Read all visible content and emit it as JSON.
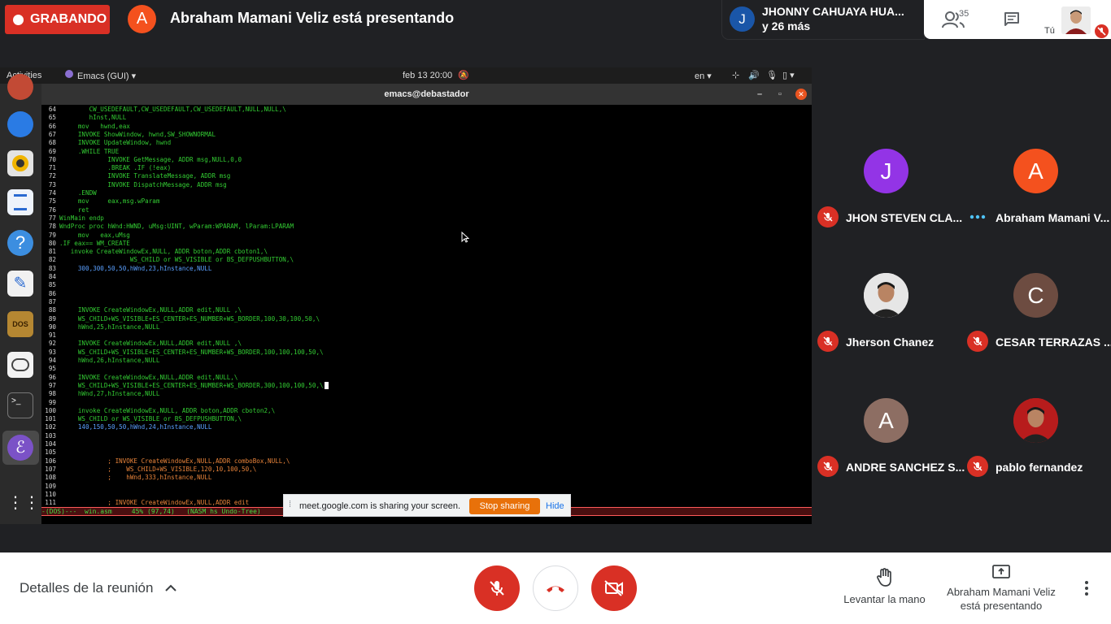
{
  "meet": {
    "recording_label": "GRABANDO",
    "presenter_initial": "A",
    "presenting_text": "Abraham Mamani Veliz está presentando",
    "speaker_initial": "J",
    "speaker_name": "JHONNY CAHUAYA HUA...",
    "speaker_more": "y 26 más",
    "people_count": "35",
    "self_label": "Tú"
  },
  "desktop": {
    "activities": "Activities",
    "app_menu": "Emacs (GUI)",
    "clock": "feb 13  20:00",
    "lang": "en",
    "window_title": "emacs@debastador"
  },
  "editor": {
    "lines": [
      {
        "n": "64",
        "t": "        CW_USEDEFAULT,CW_USEDEFAULT,CW_USEDEFAULT,NULL,NULL,\\",
        "c": "#33cc33"
      },
      {
        "n": "65",
        "t": "        hInst,NULL",
        "c": "#33cc33"
      },
      {
        "n": "66",
        "t": "     mov   hwnd,eax",
        "c": "#33cc33"
      },
      {
        "n": "67",
        "t": "     INVOKE ShowWindow, hwnd,SW_SHOWNORMAL",
        "c": "#33cc33"
      },
      {
        "n": "68",
        "t": "     INVOKE UpdateWindow, hwnd",
        "c": "#33cc33"
      },
      {
        "n": "69",
        "t": "     .WHILE TRUE",
        "c": "#33cc33"
      },
      {
        "n": "70",
        "t": "             INVOKE GetMessage, ADDR msg,NULL,0,0",
        "c": "#33cc33"
      },
      {
        "n": "71",
        "t": "             .BREAK .IF (!eax)",
        "c": "#33cc33"
      },
      {
        "n": "72",
        "t": "             INVOKE TranslateMessage, ADDR msg",
        "c": "#33cc33"
      },
      {
        "n": "73",
        "t": "             INVOKE DispatchMessage, ADDR msg",
        "c": "#33cc33"
      },
      {
        "n": "74",
        "t": "     .ENDW",
        "c": "#33cc33"
      },
      {
        "n": "75",
        "t": "     mov     eax,msg.wParam",
        "c": "#33cc33"
      },
      {
        "n": "76",
        "t": "     ret",
        "c": "#33cc33"
      },
      {
        "n": "77",
        "t": "WinMain endp",
        "c": "#33cc33"
      },
      {
        "n": "78",
        "t": "WndProc proc hWnd:HWND, uMsg:UINT, wParam:WPARAM, lParam:LPARAM",
        "c": "#33cc33"
      },
      {
        "n": "79",
        "t": "     mov   eax,uMsg",
        "c": "#33cc33"
      },
      {
        "n": "80",
        "t": ".IF eax== WM_CREATE",
        "c": "#33cc33"
      },
      {
        "n": "81",
        "t": "   invoke CreateWindowEx,NULL, ADDR boton,ADDR cboton1,\\",
        "c": "#33cc33"
      },
      {
        "n": "82",
        "t": "                   WS_CHILD or WS_VISIBLE or BS_DEFPUSHBUTTON,\\",
        "c": "#33cc33"
      },
      {
        "n": "83",
        "t": "     300,300,50,50,hWnd,23,hInstance,NULL",
        "c": "#5aa0ff"
      },
      {
        "n": "84",
        "t": "",
        "c": "#33cc33"
      },
      {
        "n": "85",
        "t": "",
        "c": "#33cc33"
      },
      {
        "n": "86",
        "t": "",
        "c": "#33cc33"
      },
      {
        "n": "87",
        "t": "",
        "c": "#33cc33"
      },
      {
        "n": "88",
        "t": "     INVOKE CreateWindowEx,NULL,ADDR edit,NULL ,\\",
        "c": "#33cc33"
      },
      {
        "n": "89",
        "t": "     WS_CHILD+WS_VISIBLE+ES_CENTER+ES_NUMBER+WS_BORDER,100,30,100,50,\\",
        "c": "#33cc33"
      },
      {
        "n": "90",
        "t": "     hWnd,25,hInstance,NULL",
        "c": "#33cc33"
      },
      {
        "n": "91",
        "t": "",
        "c": "#33cc33"
      },
      {
        "n": "92",
        "t": "     INVOKE CreateWindowEx,NULL,ADDR edit,NULL ,\\",
        "c": "#33cc33"
      },
      {
        "n": "93",
        "t": "     WS_CHILD+WS_VISIBLE+ES_CENTER+ES_NUMBER+WS_BORDER,100,100,100,50,\\",
        "c": "#33cc33"
      },
      {
        "n": "94",
        "t": "     hWnd,26,hInstance,NULL",
        "c": "#33cc33"
      },
      {
        "n": "95",
        "t": "",
        "c": "#33cc33"
      },
      {
        "n": "96",
        "t": "     INVOKE CreateWindowEx,NULL,ADDR edit,NULL,\\",
        "c": "#33cc33"
      },
      {
        "n": "97",
        "t": "     WS_CHILD+WS_VISIBLE+ES_CENTER+ES_NUMBER+WS_BORDER,300,100,100,50,\\",
        "c": "#33cc33"
      },
      {
        "n": "98",
        "t": "     hWnd,27,hInstance,NULL",
        "c": "#33cc33"
      },
      {
        "n": "99",
        "t": "",
        "c": "#33cc33"
      },
      {
        "n": "100",
        "t": "     invoke CreateWindowEx,NULL, ADDR boton,ADDR cboton2,\\",
        "c": "#33cc33"
      },
      {
        "n": "101",
        "t": "     WS_CHILD or WS_VISIBLE or BS_DEFPUSHBUTTON,\\",
        "c": "#33cc33"
      },
      {
        "n": "102",
        "t": "     140,150,50,50,hWnd,24,hInstance,NULL",
        "c": "#5aa0ff"
      },
      {
        "n": "103",
        "t": "",
        "c": "#33cc33"
      },
      {
        "n": "104",
        "t": "",
        "c": "#33cc33"
      },
      {
        "n": "105",
        "t": "",
        "c": "#33cc33"
      },
      {
        "n": "106",
        "t": "             ; INVOKE CreateWindowEx,NULL,ADDR comboBox,NULL,\\",
        "c": "#e8833a"
      },
      {
        "n": "107",
        "t": "             ;    WS_CHILD+WS_VISIBLE,120,10,100,50,\\",
        "c": "#e8833a"
      },
      {
        "n": "108",
        "t": "             ;    hWnd,333,hInstance,NULL",
        "c": "#e8833a"
      },
      {
        "n": "109",
        "t": "",
        "c": "#33cc33"
      },
      {
        "n": "110",
        "t": "",
        "c": "#33cc33"
      },
      {
        "n": "111",
        "t": "             ; INVOKE CreateWindowEx,NULL,ADDR edit",
        "c": "#e8833a"
      }
    ],
    "mode_line": "-(DOS)---  win.asm     45% (97,74)   (NASM hs Undo-Tree)"
  },
  "share_bar": {
    "message": "meet.google.com is sharing your screen.",
    "stop_label": "Stop sharing",
    "hide_label": "Hide"
  },
  "participants": [
    {
      "name": "JHON STEVEN CLA...",
      "initial": "J",
      "color": "#9334e6",
      "status": "muted",
      "photo": false
    },
    {
      "name": "Abraham Mamani V...",
      "initial": "A",
      "color": "#f4511e",
      "status": "speaking",
      "photo": false
    },
    {
      "name": "Jherson Chanez",
      "initial": "",
      "color": "#dddddd",
      "status": "muted",
      "photo": true
    },
    {
      "name": "CESAR TERRAZAS ...",
      "initial": "C",
      "color": "#6d4c41",
      "status": "muted",
      "photo": false
    },
    {
      "name": "ANDRE SANCHEZ S...",
      "initial": "A",
      "color": "#8d6e63",
      "status": "muted",
      "photo": false
    },
    {
      "name": "pablo fernandez",
      "initial": "",
      "color": "#c62828",
      "status": "muted",
      "photo": true
    }
  ],
  "bottom": {
    "details_label": "Detalles de la reunión",
    "raise_hand_label": "Levantar la mano",
    "presenting_line1": "Abraham Mamani Veliz",
    "presenting_line2": "está presentando"
  },
  "colors": {
    "danger": "#d93025",
    "accent_orange": "#e8710a",
    "link_blue": "#1a73e8"
  }
}
